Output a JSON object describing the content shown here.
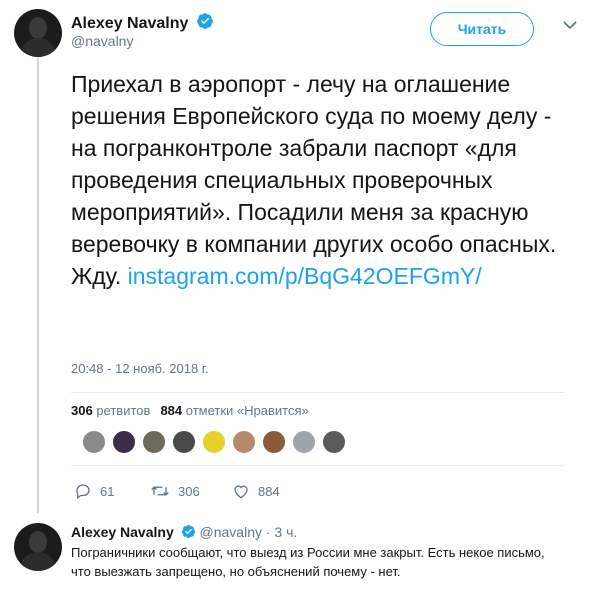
{
  "tweet": {
    "author_name": "Alexey Navalny",
    "author_handle": "@navalny",
    "follow_label": "Читать",
    "text": "Приехал в аэропорт - лечу на оглашение решения Европейского суда по моему делу - на погранконтроле забрали паспорт «для проведения специальных проверочных мероприятий». Посадили меня за красную веревочку в компании других особо опасных. Жду.",
    "link": "instagram.com/p/BqG42OEFGmY/",
    "timestamp": "20:48 - 12 нояб. 2018 г.",
    "retweets_count": "306",
    "retweets_label": "ретвитов",
    "likes_count": "884",
    "likes_label": "отметки «Нравится»"
  },
  "actions": {
    "replies": "61",
    "retweets": "306",
    "likes": "884"
  },
  "likers": [
    {
      "color": "#8a8a8a"
    },
    {
      "color": "#3d2b4a"
    },
    {
      "color": "#6e6a5a"
    },
    {
      "color": "#4a4a4a"
    },
    {
      "color": "#e6d02a"
    },
    {
      "color": "#b58a6a"
    },
    {
      "color": "#8a5a3a"
    },
    {
      "color": "#9aa5ad"
    },
    {
      "color": "#5a5a5a"
    }
  ],
  "reply": {
    "author_name": "Alexey Navalny",
    "meta": "@navalny · 3 ч.",
    "text": "Пограничники сообщают, что выезд из России мне закрыт. Есть некое письмо, что выезжать запрещено, но объяснений почему - нет."
  },
  "colors": {
    "accent": "#1da1f2",
    "muted": "#657786"
  }
}
